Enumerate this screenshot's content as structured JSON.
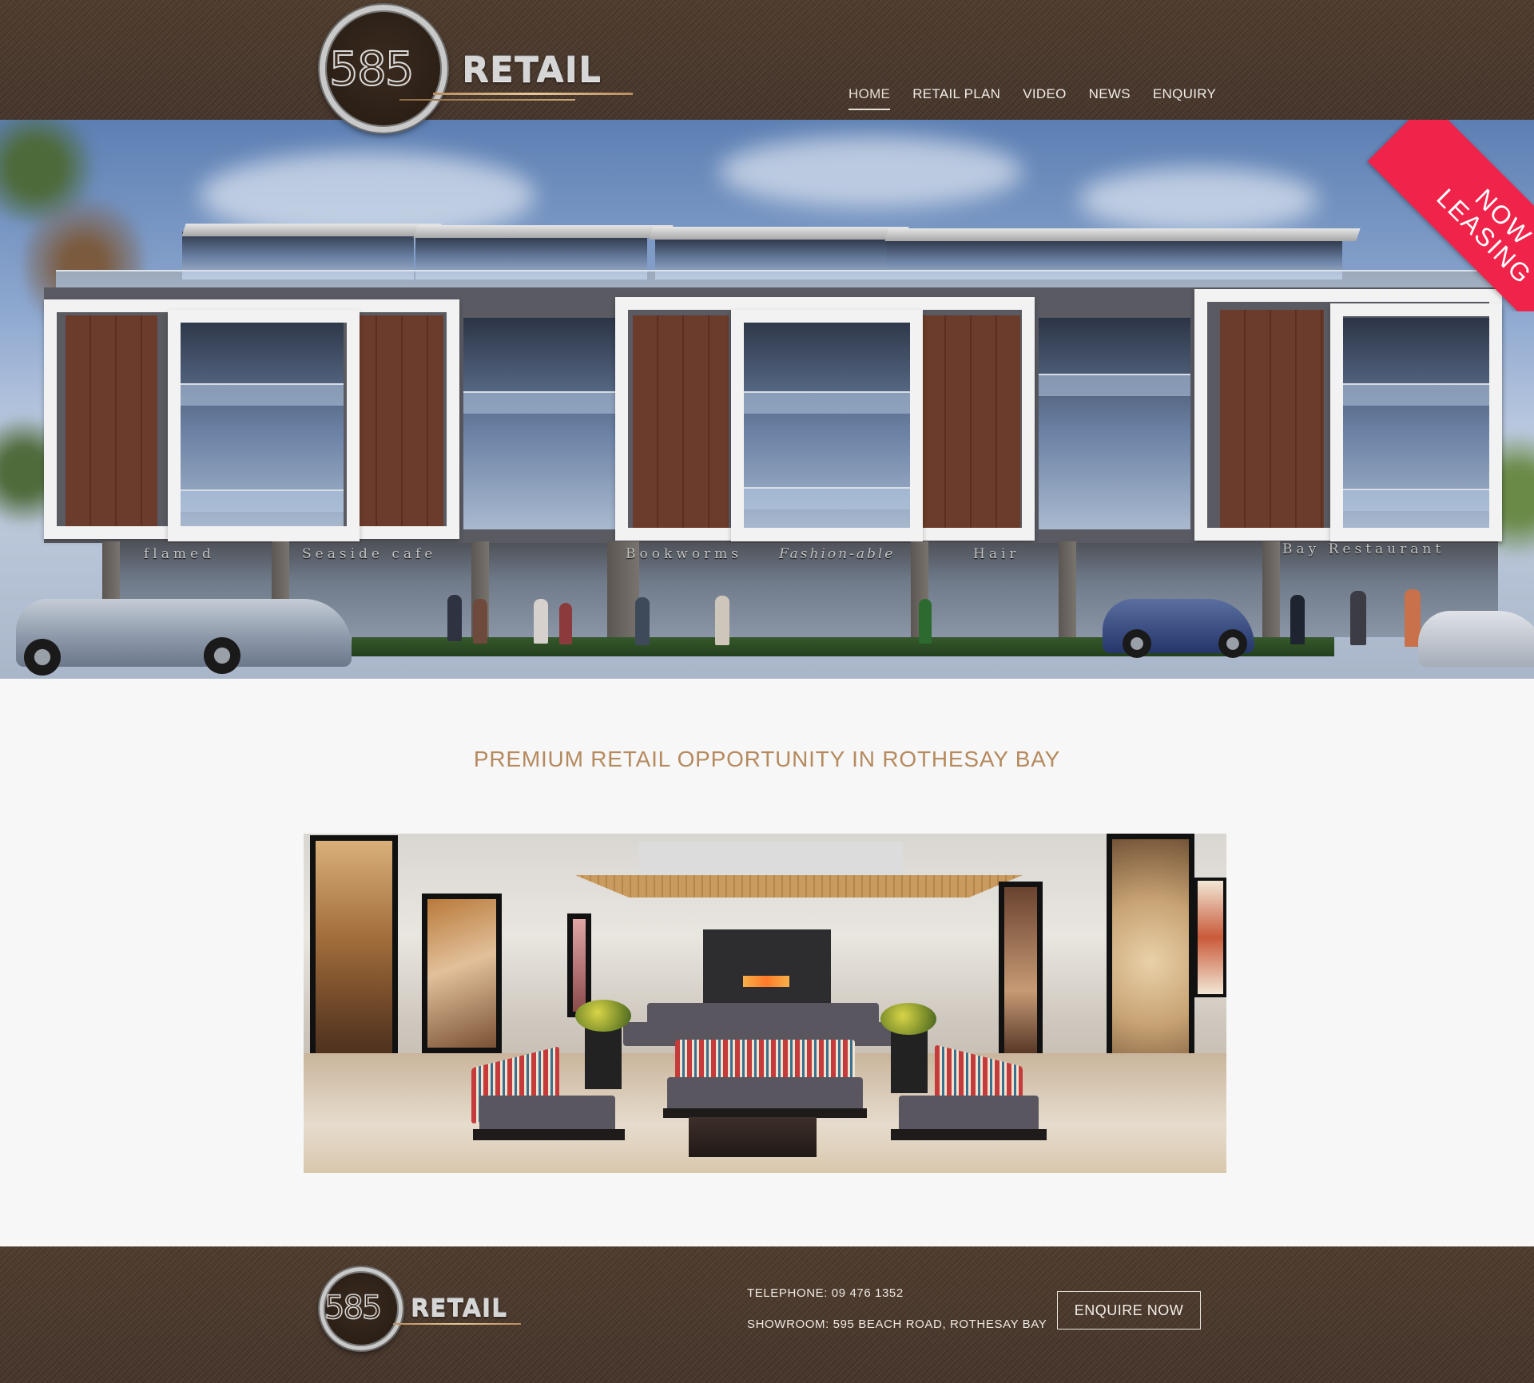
{
  "brand": {
    "logo_number": "585",
    "logo_word": "RETAIL"
  },
  "nav": {
    "items": [
      {
        "label": "HOME",
        "active": true
      },
      {
        "label": "RETAIL PLAN",
        "active": false
      },
      {
        "label": "VIDEO",
        "active": false
      },
      {
        "label": "NEWS",
        "active": false
      },
      {
        "label": "ENQUIRY",
        "active": false
      }
    ]
  },
  "hero": {
    "ribbon_line1": "NOW",
    "ribbon_line2": "LEASING",
    "ribbon_color": "#f0244a",
    "shop_signs": [
      "flamed",
      "Seaside cafe",
      "Bookworms",
      "Fashion-able",
      "Hair",
      "Bay Restaurant"
    ]
  },
  "main": {
    "tagline": "PREMIUM RETAIL OPPORTUNITY IN ROTHESAY BAY",
    "tagline_color": "#b58a5e"
  },
  "footer": {
    "telephone": "TELEPHONE: 09 476 1352",
    "showroom": "SHOWROOM: 595 BEACH ROAD, ROTHESAY BAY",
    "button_label": "ENQUIRE NOW"
  },
  "colors": {
    "bar_brown": "#4a3829",
    "page_bg": "#f7f7f7"
  }
}
